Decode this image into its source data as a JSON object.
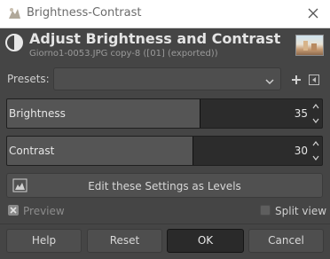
{
  "window": {
    "title": "Brightness-Contrast",
    "app_icon": "wilber-icon",
    "close_icon": "close-icon"
  },
  "header": {
    "title": "Adjust Brightness and Contrast",
    "subtitle": "Giorno1-0053.JPG copy-8 ([01] (exported))",
    "icon": "brightness-contrast-icon"
  },
  "presets": {
    "label": "Presets:",
    "value": "",
    "add_icon": "plus-icon",
    "menu_icon": "preset-menu-icon"
  },
  "sliders": [
    {
      "label": "Brightness",
      "value": "35",
      "fill_fraction": 0.61
    },
    {
      "label": "Contrast",
      "value": "30",
      "fill_fraction": 0.59
    }
  ],
  "levels_button": {
    "label": "Edit these Settings as Levels",
    "icon": "levels-icon"
  },
  "preview": {
    "label": "Preview",
    "checked": true
  },
  "split_view": {
    "label": "Split view",
    "checked": false
  },
  "buttons": {
    "help": "Help",
    "reset": "Reset",
    "ok": "OK",
    "cancel": "Cancel"
  },
  "colors": {
    "background": "#454545",
    "slider_fill": "#555555",
    "slider_track": "#2c2c2c",
    "ok_button": "#2a2a2a"
  }
}
